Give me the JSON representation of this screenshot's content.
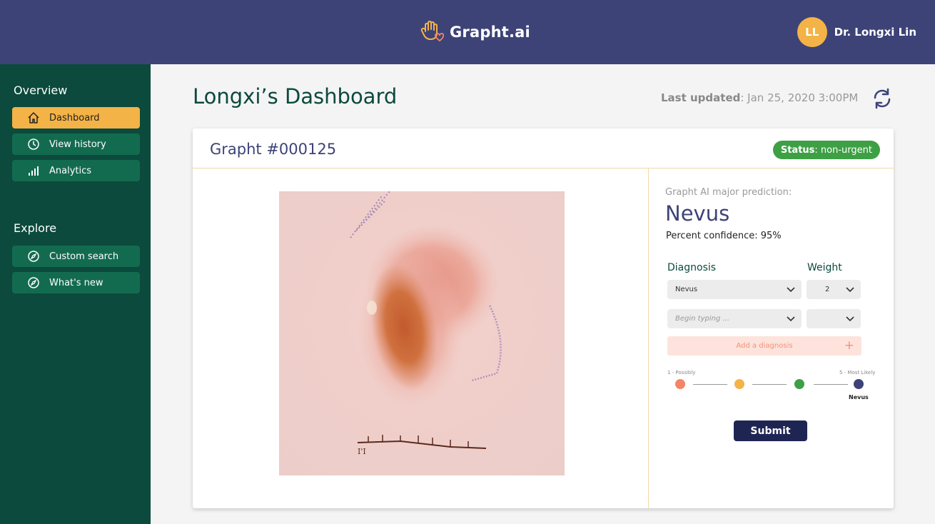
{
  "header": {
    "brand": "Grapht.ai",
    "user_initials": "LL",
    "user_name": "Dr. Longxi Lin"
  },
  "sidebar": {
    "overview_title": "Overview",
    "overview_items": [
      {
        "label": "Dashboard",
        "icon": "home-icon",
        "active": true
      },
      {
        "label": "View history",
        "icon": "clock-icon",
        "active": false
      },
      {
        "label": "Analytics",
        "icon": "bar-chart-icon",
        "active": false
      }
    ],
    "explore_title": "Explore",
    "explore_items": [
      {
        "label": "Custom search",
        "icon": "compass-icon"
      },
      {
        "label": "What's new",
        "icon": "compass-icon"
      }
    ]
  },
  "main": {
    "title": "Longxi’s Dashboard",
    "last_updated_label": "Last updated",
    "last_updated_value": ": Jan 25, 2020 3:00PM"
  },
  "case": {
    "title": "Grapht #000125",
    "status_label": "Status",
    "status_value": ": non-urgent",
    "prediction_label": "Grapht AI major prediction:",
    "prediction": "Nevus",
    "confidence": "Percent confidence: 95%",
    "diagnosis_header": "Diagnosis",
    "weight_header": "Weight",
    "rows": [
      {
        "diagnosis": "Nevus",
        "weight": "2"
      },
      {
        "diagnosis_placeholder": "Begin typing ...",
        "weight": ""
      }
    ],
    "add_label": "Add a diagnosis",
    "scale_low": "1 - Possibly",
    "scale_high": "5 - Most Likely",
    "scale_selected_label": "Nevus",
    "submit_label": "Submit"
  },
  "colors": {
    "header_bg": "#3d4377",
    "sidebar_bg": "#0b4a3c",
    "nav_item_bg": "#136b4f",
    "accent": "#f4b347",
    "status_green": "#3ea045",
    "dot_colors": [
      "#f48466",
      "#f4b347",
      "#3ea045",
      "#3d4377"
    ]
  }
}
